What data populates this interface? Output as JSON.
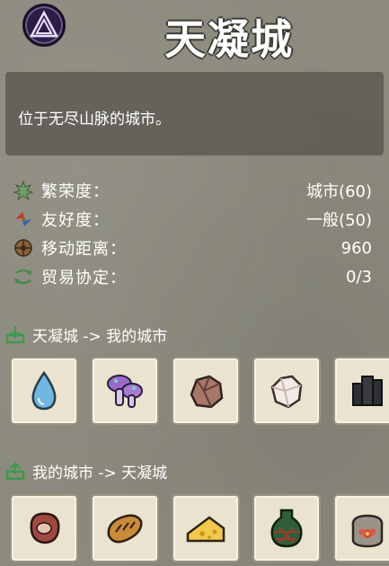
{
  "city": {
    "name": "天凝城",
    "description": "位于无尽山脉的城市。"
  },
  "stats": [
    {
      "icon": "prosperity-icon",
      "label": "繁荣度：",
      "value": "城市(60)"
    },
    {
      "icon": "friendship-icon",
      "label": "友好度：",
      "value": "一般(50)"
    },
    {
      "icon": "distance-icon",
      "label": "移动距离：",
      "value": "960"
    },
    {
      "icon": "trade-agreement-icon",
      "label": "贸易协定：",
      "value": "0/3"
    }
  ],
  "import_section": {
    "label": "天凝城 -> 我的城市",
    "icon": "import-arrow-icon",
    "items": [
      {
        "icon": "water-drop-icon"
      },
      {
        "icon": "purple-mushroom-icon"
      },
      {
        "icon": "copper-ore-icon"
      },
      {
        "icon": "white-crystal-icon"
      },
      {
        "icon": "black-stone-icon"
      }
    ]
  },
  "export_section": {
    "label": "我的城市 -> 天凝城",
    "icon": "export-arrow-icon",
    "items": [
      {
        "icon": "meat-steak-icon"
      },
      {
        "icon": "bread-loaf-icon"
      },
      {
        "icon": "cheese-icon"
      },
      {
        "icon": "wine-jug-icon"
      },
      {
        "icon": "flower-sack-icon"
      }
    ]
  },
  "colors": {
    "background": "#8c8a7d",
    "panel": "#5a5850",
    "slot_bg": "#e9e3d0",
    "accent_green": "#3d9a4a"
  }
}
